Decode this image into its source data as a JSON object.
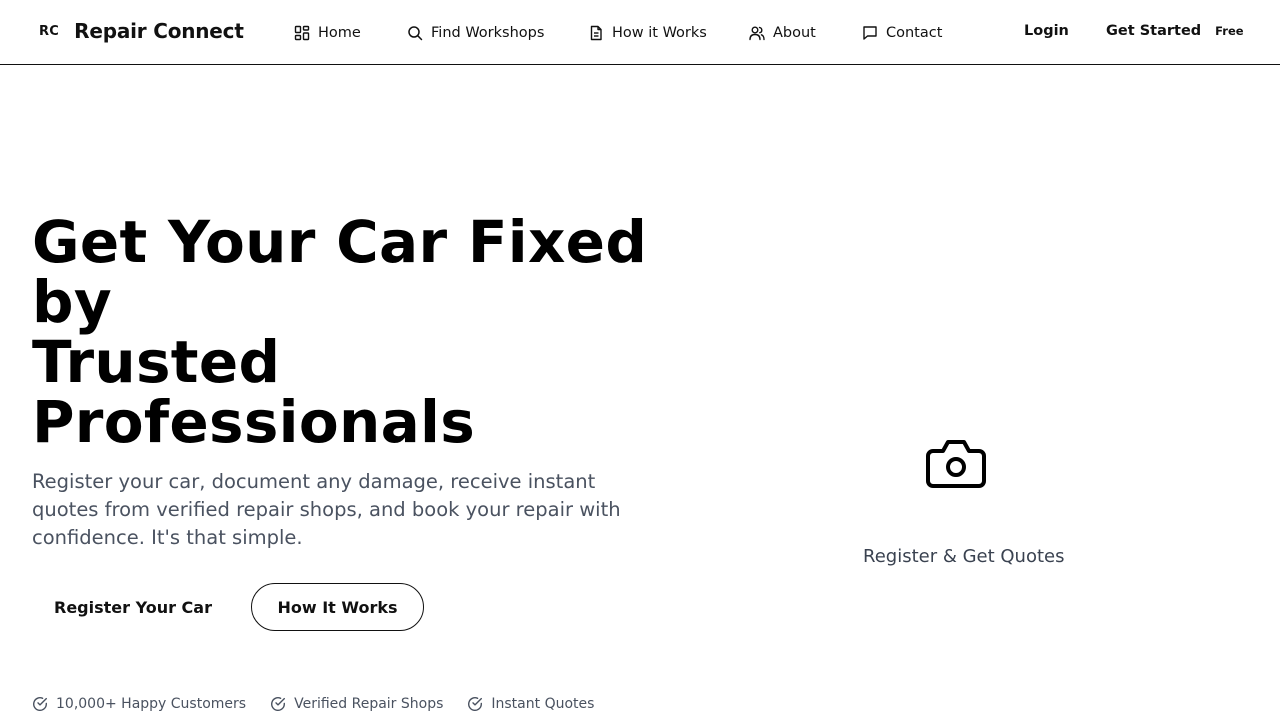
{
  "brand": {
    "mark": "RC",
    "name": "Repair Connect"
  },
  "nav": {
    "home": {
      "label": "Home",
      "icon": "grid-icon"
    },
    "find": {
      "label": "Find Workshops",
      "icon": "search-icon"
    },
    "how": {
      "label": "How it Works",
      "icon": "document-icon"
    },
    "about": {
      "label": "About",
      "icon": "users-icon"
    },
    "contact": {
      "label": "Contact",
      "icon": "chat-icon"
    }
  },
  "auth": {
    "login": "Login",
    "get_started": "Get Started",
    "free_badge": "Free"
  },
  "hero": {
    "title_lines": [
      "Get Your Car Fixed",
      "by",
      "Trusted",
      "Professionals"
    ],
    "subtitle": "Register your car, document any damage, receive instant quotes from verified repair shops, and book your repair with confidence. It's that simple.",
    "primary_cta": "Register Your Car",
    "secondary_cta": "How It Works"
  },
  "features": [
    "10,000+ Happy Customers",
    "Verified Repair Shops",
    "Instant Quotes"
  ],
  "illustration": {
    "icon": "camera-icon",
    "caption": "Register & Get Quotes"
  },
  "colors": {
    "text": "#000000",
    "muted": "#4a5260",
    "border": "#111111",
    "background": "#ffffff"
  }
}
